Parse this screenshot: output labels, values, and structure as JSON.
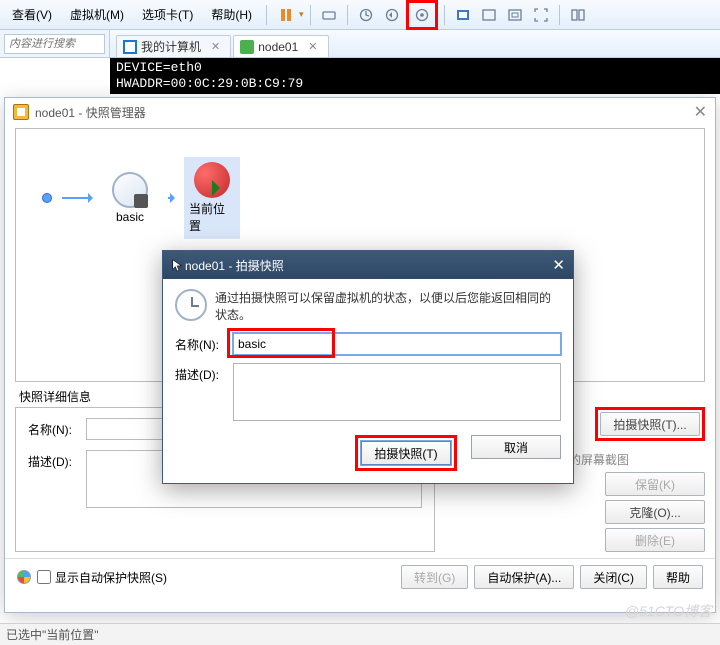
{
  "menu": {
    "view": "查看(V)",
    "vm": "虚拟机(M)",
    "tabs": "选项卡(T)",
    "help": "帮助(H)"
  },
  "tabs": {
    "computer": "我的计算机",
    "node": "node01"
  },
  "sidebar": {
    "search_placeholder": "内容进行搜索"
  },
  "terminal": {
    "line1": "DEVICE=eth0",
    "line2": "HWADDR=00:0C:29:0B:C9:79"
  },
  "manager": {
    "title": "node01 - 快照管理器",
    "snapshot_name": "basic",
    "here_label": "当前位置",
    "details_header": "快照详细信息",
    "name_label": "名称(N):",
    "desc_label": "描述(D):",
    "name_value": "",
    "desc_value": "",
    "no_screenshot": "没有可用的屏幕截图",
    "btn_take": "拍摄快照(T)...",
    "btn_keep": "保留(K)",
    "btn_clone": "克隆(O)...",
    "btn_delete": "删除(E)",
    "checkbox": "显示自动保护快照(S)",
    "btn_goto": "转到(G)",
    "btn_autoprotect": "自动保护(A)...",
    "btn_close": "关闭(C)",
    "btn_help": "帮助"
  },
  "modal": {
    "title": "node01 - 拍摄快照",
    "intro": "通过拍摄快照可以保留虚拟机的状态，以便以后您能返回相同的状态。",
    "name_label": "名称(N):",
    "desc_label": "描述(D):",
    "name_value": "basic",
    "desc_value": "",
    "btn_take": "拍摄快照(T)",
    "btn_cancel": "取消"
  },
  "status": {
    "text": "已选中\"当前位置\""
  },
  "watermark": "@51CTO博客"
}
